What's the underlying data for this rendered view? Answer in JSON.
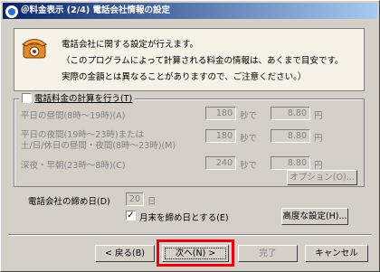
{
  "window": {
    "title": "＠料金表示 (2/4) 電話会社情報の設定"
  },
  "info": {
    "line1": "電話会社に関する設定が行えます。",
    "line2": "（このプログラムによって計算される料金の情報は、あくまで目安です。",
    "line3": "実際の金額とは異なることがありますので、ご注意ください。）"
  },
  "calc": {
    "checkbox_label": "電話料金の計算を行う(T)",
    "checked": false,
    "rows": [
      {
        "label1": "平日の昼間(8時～19時)(A)",
        "label2": "",
        "seconds": "180",
        "sec_unit": "秒で",
        "yen": "8.80",
        "yen_unit": "円"
      },
      {
        "label1": "平日の夜間(19時～23時)または",
        "label2": "土/日/休日の昼間・夜間(8時～23時)(M)",
        "seconds": "180",
        "sec_unit": "秒で",
        "yen": "8.80",
        "yen_unit": "円"
      },
      {
        "label1": "深夜・早朝(23時～8時)(C)",
        "label2": "",
        "seconds": "240",
        "sec_unit": "秒で",
        "yen": "8.80",
        "yen_unit": "円"
      }
    ],
    "options_button": "オプション(O)..."
  },
  "closing": {
    "label": "電話会社の締め日(D)",
    "day": "20",
    "day_unit": "日",
    "month_end_label": "月末を締め日とする(E)",
    "month_end_checked": true,
    "advanced_button": "高度な設定(H)..."
  },
  "footer": {
    "back": "< 戻る(B)",
    "next": "次へ(N) >",
    "finish": "完了",
    "cancel": "キャンセル"
  },
  "colors": {
    "highlight": "#e60012",
    "title_start": "#0a246a",
    "title_end": "#a6caf0",
    "info_bg": "#f6f2e8"
  }
}
